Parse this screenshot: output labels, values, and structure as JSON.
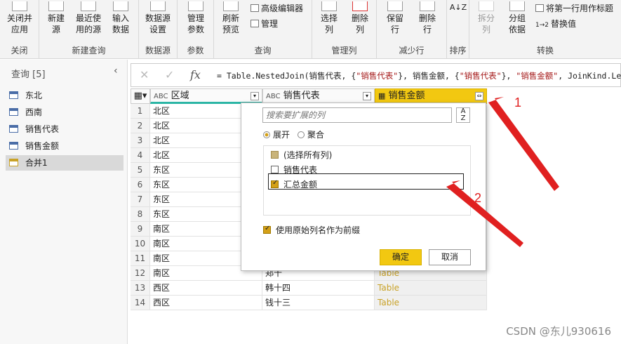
{
  "ribbon": {
    "groups": [
      {
        "label": "关闭"
      },
      {
        "label": "新建查询"
      },
      {
        "label": "数据源"
      },
      {
        "label": "参数"
      },
      {
        "label": "查询"
      },
      {
        "label": "管理列"
      },
      {
        "label": "减少行"
      },
      {
        "label": "排序"
      },
      {
        "label": "转换"
      }
    ],
    "buttons": {
      "close_apply": [
        "关闭并",
        "应用"
      ],
      "new_source": [
        "新建",
        "源"
      ],
      "recent_sources": [
        "最近使",
        "用的源"
      ],
      "enter_data": [
        "输入",
        "数据"
      ],
      "data_source_settings": [
        "数据源",
        "设置"
      ],
      "manage_params": [
        "管理",
        "参数"
      ],
      "refresh_preview": [
        "刷新",
        "预览"
      ],
      "advanced_editor": "高级编辑器",
      "manage": "管理",
      "choose_columns": [
        "选择",
        "列"
      ],
      "remove_columns": [
        "删除",
        "列"
      ],
      "keep_rows": [
        "保留",
        "行"
      ],
      "remove_rows": [
        "删除",
        "行"
      ],
      "split_column": [
        "拆分",
        "列"
      ],
      "group_by": [
        "分组",
        "依据"
      ],
      "use_first_row": "将第一行用作标题",
      "replace_values": "替换值"
    }
  },
  "queries": {
    "title": "查询 [5]",
    "items": [
      {
        "label": "东北"
      },
      {
        "label": "西南"
      },
      {
        "label": "销售代表"
      },
      {
        "label": "销售金额"
      },
      {
        "label": "合并1"
      }
    ]
  },
  "formula": {
    "fx": "fx",
    "p1": "= Table.NestedJoin(销售代表, {",
    "s1": "\"销售代表\"",
    "p2": "}, 销售金额, {",
    "s2": "\"销售代表\"",
    "p3": "}, ",
    "s3": "\"销售金额\"",
    "p4": ", JoinKind.Lef"
  },
  "table": {
    "columns": [
      {
        "label": "区域",
        "type": "ABC"
      },
      {
        "label": "销售代表",
        "type": "ABC"
      },
      {
        "label": "销售金额",
        "type": "table"
      }
    ],
    "rows": [
      {
        "n": "1",
        "region": "北区",
        "rep": "",
        "val": ""
      },
      {
        "n": "2",
        "region": "北区",
        "rep": "",
        "val": ""
      },
      {
        "n": "3",
        "region": "北区",
        "rep": "",
        "val": ""
      },
      {
        "n": "4",
        "region": "北区",
        "rep": "",
        "val": ""
      },
      {
        "n": "5",
        "region": "东区",
        "rep": "",
        "val": ""
      },
      {
        "n": "6",
        "region": "东区",
        "rep": "",
        "val": ""
      },
      {
        "n": "7",
        "region": "东区",
        "rep": "",
        "val": ""
      },
      {
        "n": "8",
        "region": "东区",
        "rep": "",
        "val": ""
      },
      {
        "n": "9",
        "region": "南区",
        "rep": "",
        "val": ""
      },
      {
        "n": "10",
        "region": "南区",
        "rep": "",
        "val": ""
      },
      {
        "n": "11",
        "region": "南区",
        "rep": "",
        "val": ""
      },
      {
        "n": "12",
        "region": "南区",
        "rep": "郑十",
        "val": "Table"
      },
      {
        "n": "13",
        "region": "西区",
        "rep": "韩十四",
        "val": "Table"
      },
      {
        "n": "14",
        "region": "西区",
        "rep": "钱十三",
        "val": "Table"
      }
    ]
  },
  "popup": {
    "search_placeholder": "搜索要扩展的列",
    "expand": "展开",
    "aggregate": "聚合",
    "items": [
      {
        "label": "(选择所有列)",
        "state": "partial"
      },
      {
        "label": "销售代表",
        "state": "off"
      },
      {
        "label": "汇总金额",
        "state": "on"
      }
    ],
    "prefix_label": "使用原始列名作为前缀",
    "ok": "确定",
    "cancel": "取消"
  },
  "annotations": {
    "one": "1",
    "two": "2"
  },
  "watermark": "CSDN @东儿930616",
  "colors": {
    "accent": "#f2c811",
    "arrow": "#e02020"
  }
}
